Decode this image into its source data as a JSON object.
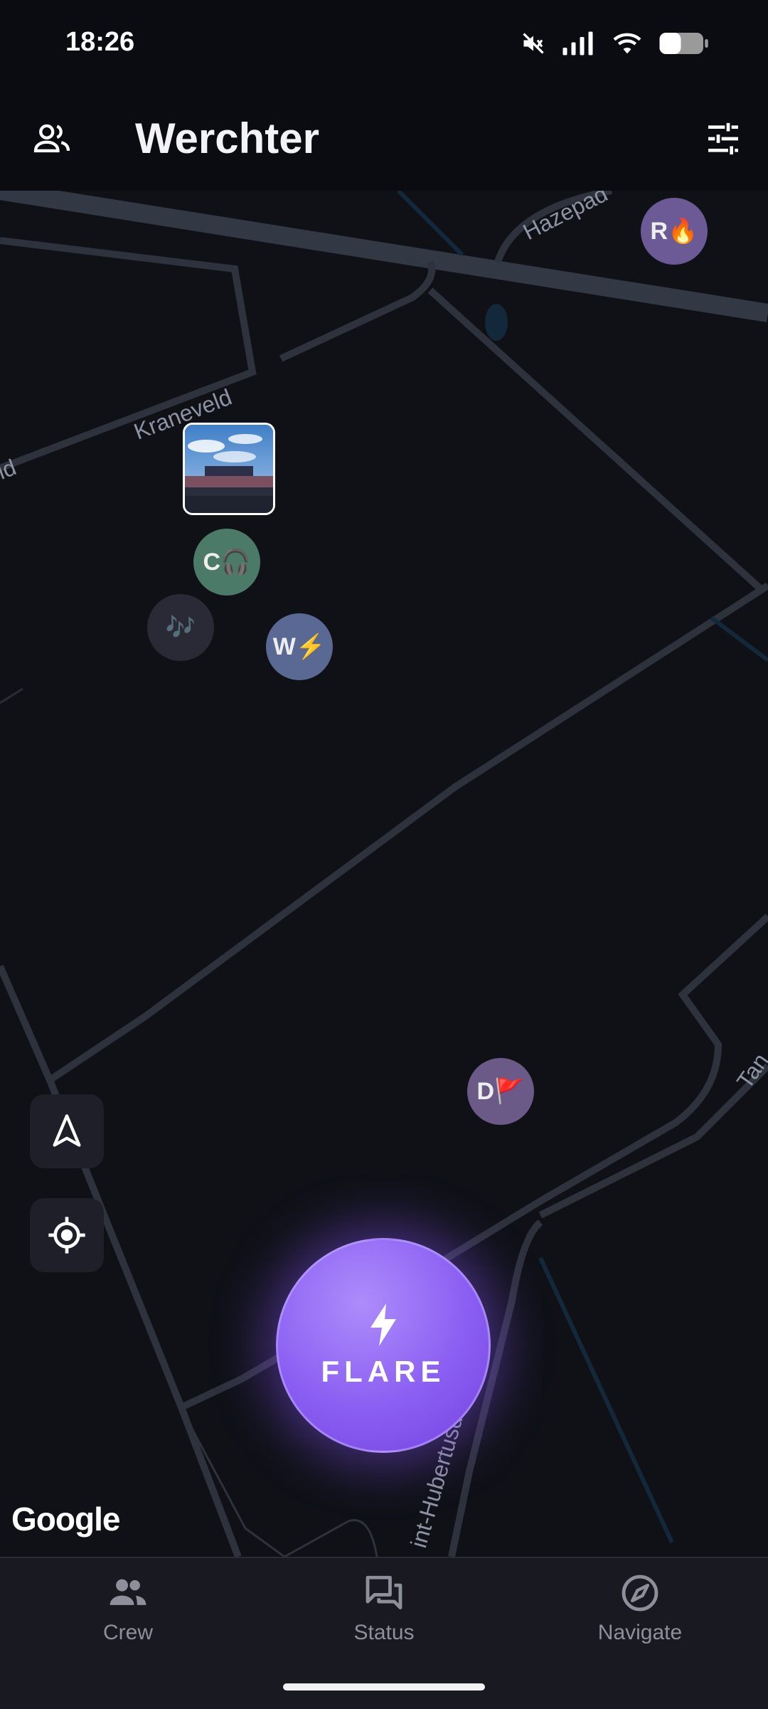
{
  "status_bar": {
    "time": "18:26"
  },
  "app_bar": {
    "title": "Werchter"
  },
  "map": {
    "road_labels": {
      "hazepad": "Hazepad",
      "kraneveld": "Kraneveld",
      "left_edge": "ld",
      "right_edge": "Tan",
      "hubertus": "int-Hubertusdreef"
    },
    "markers": {
      "r": {
        "letter": "R",
        "emoji": "🔥",
        "color": "#6b5a96"
      },
      "c": {
        "letter": "C",
        "emoji": "🎧",
        "color": "#4b7a68"
      },
      "music": {
        "emoji": "🎶",
        "color": "#2a2a36"
      },
      "w": {
        "letter": "W",
        "emoji": "⚡",
        "color": "#5a6894"
      },
      "d": {
        "letter": "D",
        "emoji": "🚩",
        "color": "#6b5a88"
      }
    },
    "attribution": "Google"
  },
  "flare": {
    "label": "FLARE",
    "color": "#8a5ef2"
  },
  "bottom_nav": {
    "items": [
      {
        "label": "Crew",
        "icon": "people-icon"
      },
      {
        "label": "Status",
        "icon": "chat-icon"
      },
      {
        "label": "Navigate",
        "icon": "compass-icon"
      }
    ]
  }
}
